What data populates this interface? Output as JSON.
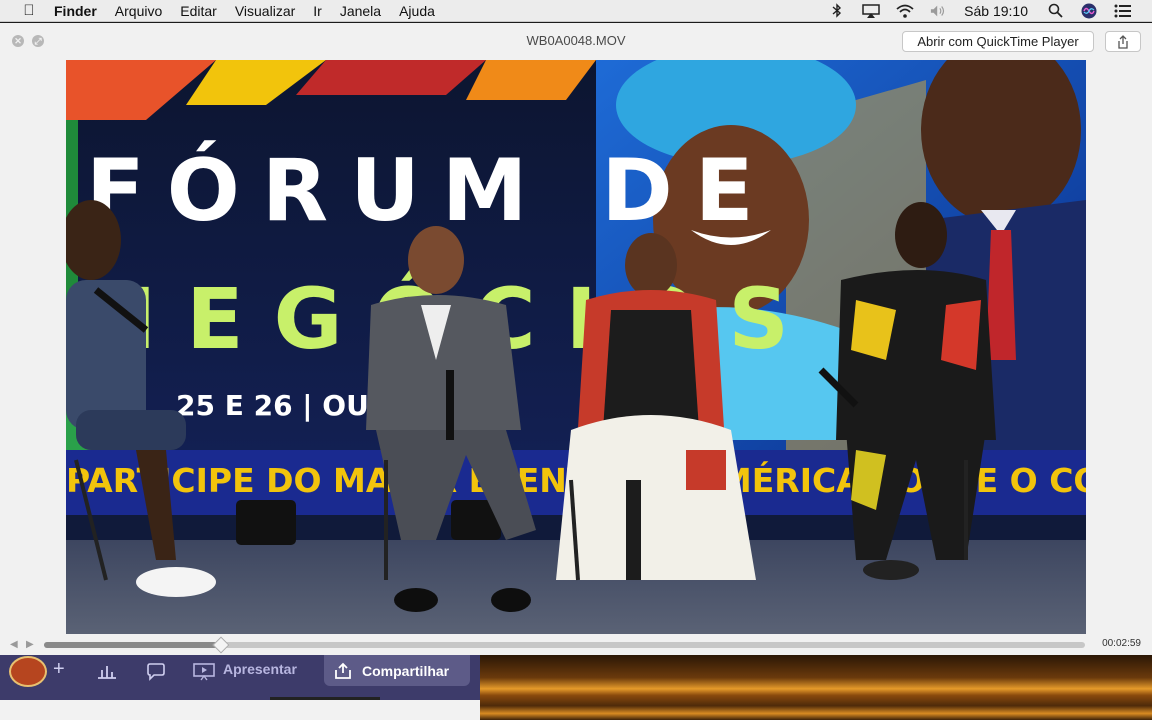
{
  "menubar": {
    "app_name": "Finder",
    "items": [
      "Arquivo",
      "Editar",
      "Visualizar",
      "Ir",
      "Janela",
      "Ajuda"
    ],
    "clock": "Sáb 19:10",
    "icons": [
      "apple-icon",
      "bluetooth-icon",
      "airplay-icon",
      "wifi-icon",
      "volume-icon",
      "search-icon",
      "siri-icon",
      "notification-center-icon"
    ]
  },
  "window": {
    "title": "WB0A0048.MOV",
    "open_button": "Abrir com QuickTime Player",
    "controls": [
      "close-icon",
      "fullscreen-icon"
    ],
    "share_icon": "share-icon"
  },
  "video": {
    "banner_line1": "FÓRUM DE",
    "banner_line2": "NEGÓCIOS",
    "banner_date": "25 E 26 | OUTUBR",
    "banner_bottom": "PARTICIPE DO MAIOR EVENTO DA AMÉRICA SOBRE O CO"
  },
  "playback": {
    "timecode": "00:02:59",
    "progress": 0.17
  },
  "background_app": {
    "present_label": "Apresentar",
    "share_label": "Compartilhar"
  },
  "colors": {
    "menubar_bg": "#ececec",
    "window_bg": "#f1f1f1",
    "banner_dark": "#0e1730",
    "banner_green": "#c8f06a",
    "banner_yellow": "#f2c40c",
    "bg_app_purple": "#3d3b6a"
  }
}
